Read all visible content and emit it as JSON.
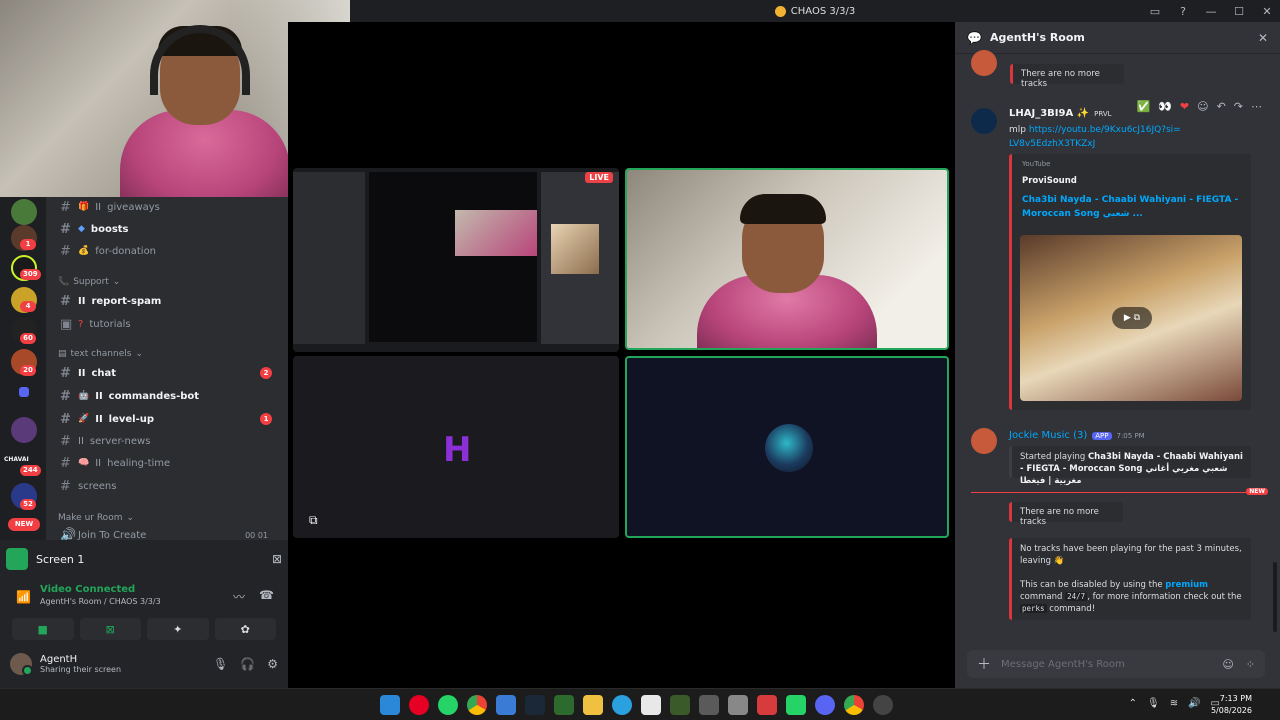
{
  "window": {
    "title": "CHAOS 3/3/3",
    "controls": [
      "▭",
      "?",
      "—",
      "☐",
      "✕"
    ]
  },
  "sidebar": {
    "servers": {
      "badges": [
        "1",
        "309",
        "4",
        "60",
        "20",
        "244",
        "52"
      ],
      "new_label": "NEW",
      "chavai_label": "CHAVAI"
    },
    "channels": [
      {
        "name": "giveaways",
        "prefix": "II",
        "emoji": "🎁",
        "bold": false
      },
      {
        "name": "boosts",
        "prefix": "",
        "emoji": "◆",
        "bold": true
      },
      {
        "name": "for-donation",
        "prefix": "",
        "emoji": "💰",
        "bold": false
      }
    ],
    "support_category": "Support",
    "support_channels": [
      {
        "name": "report-spam",
        "prefix": "II",
        "bold": true
      },
      {
        "name": "tutorials",
        "prefix": "?",
        "bold": false
      }
    ],
    "text_category": "text channels",
    "text_channels": [
      {
        "name": "chat",
        "prefix": "II",
        "bold": true,
        "badge": "2"
      },
      {
        "name": "commandes-bot",
        "prefix": "II",
        "bold": true,
        "badge": ""
      },
      {
        "name": "level-up",
        "prefix": "II",
        "bold": true,
        "badge": "1"
      },
      {
        "name": "server-news",
        "prefix": "II",
        "bold": false,
        "badge": ""
      },
      {
        "name": "healing-time",
        "prefix": "II",
        "bold": false,
        "badge": ""
      },
      {
        "name": "screens",
        "prefix": "",
        "bold": false,
        "badge": ""
      }
    ],
    "room_category": "Make ur Room",
    "room_channel": "Join To Create",
    "room_counts": "00 01"
  },
  "voice": {
    "screen_label": "Screen 1",
    "status": "Video Connected",
    "location": "AgentH's Room / CHAOS 3/3/3",
    "user_name": "AgentH",
    "user_status": "Sharing their screen"
  },
  "stage": {
    "live_label": "LIVE",
    "logo_letter": "H"
  },
  "chat": {
    "room_title": "AgentH's Room",
    "top_message": "There are no more tracks",
    "msg1_user": "LHAJ_3BI9A ✨",
    "msg1_tag": "PRVL",
    "msg1_prefix": "mlp",
    "msg1_link": "https://youtu.be/9Kxu6cJ16JQ?si=LV8v5EdzhX3TKZxJ",
    "embed_provider": "YouTube",
    "embed_author": "ProviSound",
    "embed_title": "Cha3bi Nayda - Chaabi Wahiyani - FIEGTA - Moroccan Song شعبي ...",
    "msg2_user": "Jockie Music (3)",
    "msg2_tag": "APP",
    "msg2_time": "7:05 PM",
    "msg2_text_prefix": "Started playing",
    "msg2_track": "Cha3bi Nayda - Chaabi Wahiyani - FIEGTA - Moroccan Song شعبي مغربي أغاني مغربية | فيغطا",
    "new_label": "NEW",
    "no_more_tracks": "There are no more tracks",
    "leaving_line": "No tracks have been playing for the past 3 minutes, leaving 👋",
    "disable_prefix": "This can be disabled by using the",
    "premium_word": "premium",
    "disable_mid": "command",
    "code_247": "24/7",
    "disable_mid2": ", for more information check out the",
    "code_perks": "perks",
    "disable_end": "command!",
    "input_placeholder": "Message AgentH's Room"
  },
  "taskbar": {
    "time": "7:13 PM",
    "date": "5/08/2026"
  },
  "colors": {
    "accent_green": "#23a55a",
    "danger_red": "#f23f43",
    "link_blue": "#00a8fc",
    "bg_dark": "#1e1f22",
    "bg_mid": "#2b2d31",
    "bg_chat": "#313338"
  }
}
